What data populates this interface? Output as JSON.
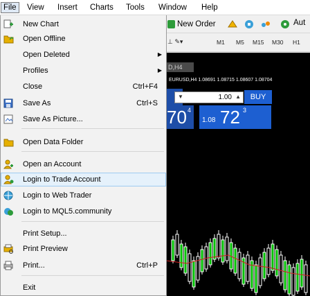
{
  "menubar": {
    "items": [
      {
        "label": "File"
      },
      {
        "label": "View"
      },
      {
        "label": "Insert"
      },
      {
        "label": "Charts"
      },
      {
        "label": "Tools"
      },
      {
        "label": "Window"
      },
      {
        "label": "Help"
      }
    ]
  },
  "toolbar": {
    "new_order": "New Order",
    "autotrading": "Aut",
    "timeframes": [
      "M1",
      "M5",
      "M15",
      "M30",
      "H1"
    ]
  },
  "chart": {
    "tab_label": "D,H4",
    "quote_line": "EURUSD,H4  1.08691 1.08715 1.08607 1.08704",
    "lot_value": "1.00",
    "buy_label": "BUY",
    "sell_price_big": "70",
    "sell_price_sup": "4",
    "buy_price_small": "1.08",
    "buy_price_big": "72",
    "buy_price_sup": "3"
  },
  "file_menu": {
    "items": [
      {
        "label": "New Chart",
        "icon": "new-chart-icon"
      },
      {
        "label": "Open Offline",
        "icon": "folder-icon"
      },
      {
        "label": "Open Deleted",
        "submenu": true
      },
      {
        "label": "Profiles",
        "submenu": true
      },
      {
        "label": "Close",
        "shortcut": "Ctrl+F4"
      },
      {
        "label": "Save As",
        "shortcut": "Ctrl+S",
        "icon": "save-icon"
      },
      {
        "label": "Save As Picture...",
        "icon": "picture-icon"
      },
      {
        "label": "Open Data Folder",
        "icon": "folder-icon"
      },
      {
        "label": "Open an Account",
        "icon": "account-icon"
      },
      {
        "label": "Login to Trade Account",
        "icon": "login-icon",
        "highlighted": true
      },
      {
        "label": "Login to Web Trader",
        "icon": "web-trader-icon"
      },
      {
        "label": "Login to MQL5.community",
        "icon": "mql5-icon"
      },
      {
        "label": "Print Setup..."
      },
      {
        "label": "Print Preview",
        "icon": "print-preview-icon"
      },
      {
        "label": "Print...",
        "shortcut": "Ctrl+P",
        "icon": "printer-icon"
      },
      {
        "label": "Exit"
      }
    ]
  },
  "colors": {
    "highlight_bg": "#e5f1fb",
    "buy_blue": "#1d5fd1",
    "sell_blue": "#1e4ea8",
    "chart_bg": "#000000"
  }
}
